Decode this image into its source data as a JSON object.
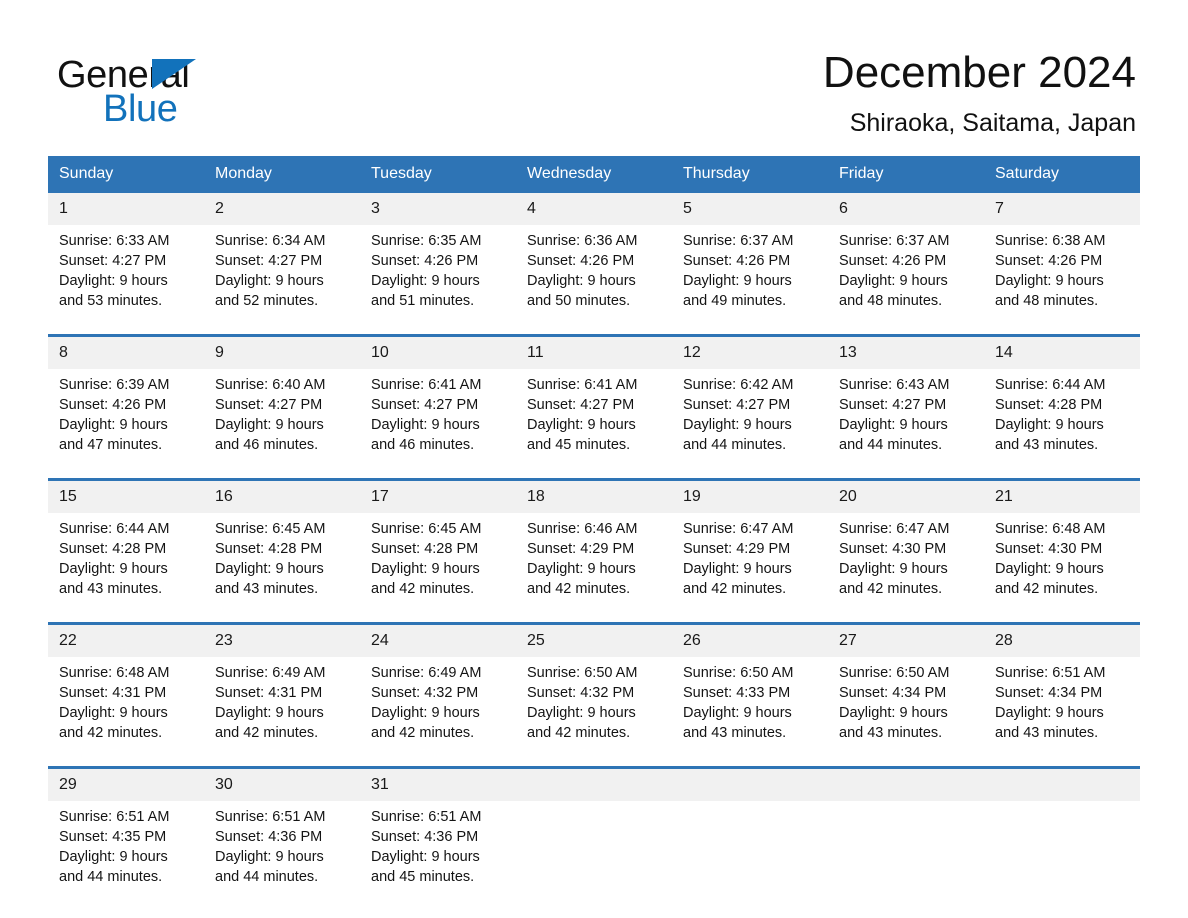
{
  "brand": {
    "name_part1": "General",
    "name_part2": "Blue",
    "accent_color": "#1272bb"
  },
  "header": {
    "title": "December 2024",
    "location": "Shiraoka, Saitama, Japan"
  },
  "theme": {
    "header_blue": "#2e74b5",
    "daynum_band": "#f1f1f1",
    "text": "#141414"
  },
  "weekdays": [
    "Sunday",
    "Monday",
    "Tuesday",
    "Wednesday",
    "Thursday",
    "Friday",
    "Saturday"
  ],
  "weeks": [
    {
      "days": [
        {
          "date": "1",
          "sunrise": "Sunrise: 6:33 AM",
          "sunset": "Sunset: 4:27 PM",
          "daylight1": "Daylight: 9 hours",
          "daylight2": "and 53 minutes."
        },
        {
          "date": "2",
          "sunrise": "Sunrise: 6:34 AM",
          "sunset": "Sunset: 4:27 PM",
          "daylight1": "Daylight: 9 hours",
          "daylight2": "and 52 minutes."
        },
        {
          "date": "3",
          "sunrise": "Sunrise: 6:35 AM",
          "sunset": "Sunset: 4:26 PM",
          "daylight1": "Daylight: 9 hours",
          "daylight2": "and 51 minutes."
        },
        {
          "date": "4",
          "sunrise": "Sunrise: 6:36 AM",
          "sunset": "Sunset: 4:26 PM",
          "daylight1": "Daylight: 9 hours",
          "daylight2": "and 50 minutes."
        },
        {
          "date": "5",
          "sunrise": "Sunrise: 6:37 AM",
          "sunset": "Sunset: 4:26 PM",
          "daylight1": "Daylight: 9 hours",
          "daylight2": "and 49 minutes."
        },
        {
          "date": "6",
          "sunrise": "Sunrise: 6:37 AM",
          "sunset": "Sunset: 4:26 PM",
          "daylight1": "Daylight: 9 hours",
          "daylight2": "and 48 minutes."
        },
        {
          "date": "7",
          "sunrise": "Sunrise: 6:38 AM",
          "sunset": "Sunset: 4:26 PM",
          "daylight1": "Daylight: 9 hours",
          "daylight2": "and 48 minutes."
        }
      ]
    },
    {
      "days": [
        {
          "date": "8",
          "sunrise": "Sunrise: 6:39 AM",
          "sunset": "Sunset: 4:26 PM",
          "daylight1": "Daylight: 9 hours",
          "daylight2": "and 47 minutes."
        },
        {
          "date": "9",
          "sunrise": "Sunrise: 6:40 AM",
          "sunset": "Sunset: 4:27 PM",
          "daylight1": "Daylight: 9 hours",
          "daylight2": "and 46 minutes."
        },
        {
          "date": "10",
          "sunrise": "Sunrise: 6:41 AM",
          "sunset": "Sunset: 4:27 PM",
          "daylight1": "Daylight: 9 hours",
          "daylight2": "and 46 minutes."
        },
        {
          "date": "11",
          "sunrise": "Sunrise: 6:41 AM",
          "sunset": "Sunset: 4:27 PM",
          "daylight1": "Daylight: 9 hours",
          "daylight2": "and 45 minutes."
        },
        {
          "date": "12",
          "sunrise": "Sunrise: 6:42 AM",
          "sunset": "Sunset: 4:27 PM",
          "daylight1": "Daylight: 9 hours",
          "daylight2": "and 44 minutes."
        },
        {
          "date": "13",
          "sunrise": "Sunrise: 6:43 AM",
          "sunset": "Sunset: 4:27 PM",
          "daylight1": "Daylight: 9 hours",
          "daylight2": "and 44 minutes."
        },
        {
          "date": "14",
          "sunrise": "Sunrise: 6:44 AM",
          "sunset": "Sunset: 4:28 PM",
          "daylight1": "Daylight: 9 hours",
          "daylight2": "and 43 minutes."
        }
      ]
    },
    {
      "days": [
        {
          "date": "15",
          "sunrise": "Sunrise: 6:44 AM",
          "sunset": "Sunset: 4:28 PM",
          "daylight1": "Daylight: 9 hours",
          "daylight2": "and 43 minutes."
        },
        {
          "date": "16",
          "sunrise": "Sunrise: 6:45 AM",
          "sunset": "Sunset: 4:28 PM",
          "daylight1": "Daylight: 9 hours",
          "daylight2": "and 43 minutes."
        },
        {
          "date": "17",
          "sunrise": "Sunrise: 6:45 AM",
          "sunset": "Sunset: 4:28 PM",
          "daylight1": "Daylight: 9 hours",
          "daylight2": "and 42 minutes."
        },
        {
          "date": "18",
          "sunrise": "Sunrise: 6:46 AM",
          "sunset": "Sunset: 4:29 PM",
          "daylight1": "Daylight: 9 hours",
          "daylight2": "and 42 minutes."
        },
        {
          "date": "19",
          "sunrise": "Sunrise: 6:47 AM",
          "sunset": "Sunset: 4:29 PM",
          "daylight1": "Daylight: 9 hours",
          "daylight2": "and 42 minutes."
        },
        {
          "date": "20",
          "sunrise": "Sunrise: 6:47 AM",
          "sunset": "Sunset: 4:30 PM",
          "daylight1": "Daylight: 9 hours",
          "daylight2": "and 42 minutes."
        },
        {
          "date": "21",
          "sunrise": "Sunrise: 6:48 AM",
          "sunset": "Sunset: 4:30 PM",
          "daylight1": "Daylight: 9 hours",
          "daylight2": "and 42 minutes."
        }
      ]
    },
    {
      "days": [
        {
          "date": "22",
          "sunrise": "Sunrise: 6:48 AM",
          "sunset": "Sunset: 4:31 PM",
          "daylight1": "Daylight: 9 hours",
          "daylight2": "and 42 minutes."
        },
        {
          "date": "23",
          "sunrise": "Sunrise: 6:49 AM",
          "sunset": "Sunset: 4:31 PM",
          "daylight1": "Daylight: 9 hours",
          "daylight2": "and 42 minutes."
        },
        {
          "date": "24",
          "sunrise": "Sunrise: 6:49 AM",
          "sunset": "Sunset: 4:32 PM",
          "daylight1": "Daylight: 9 hours",
          "daylight2": "and 42 minutes."
        },
        {
          "date": "25",
          "sunrise": "Sunrise: 6:50 AM",
          "sunset": "Sunset: 4:32 PM",
          "daylight1": "Daylight: 9 hours",
          "daylight2": "and 42 minutes."
        },
        {
          "date": "26",
          "sunrise": "Sunrise: 6:50 AM",
          "sunset": "Sunset: 4:33 PM",
          "daylight1": "Daylight: 9 hours",
          "daylight2": "and 43 minutes."
        },
        {
          "date": "27",
          "sunrise": "Sunrise: 6:50 AM",
          "sunset": "Sunset: 4:34 PM",
          "daylight1": "Daylight: 9 hours",
          "daylight2": "and 43 minutes."
        },
        {
          "date": "28",
          "sunrise": "Sunrise: 6:51 AM",
          "sunset": "Sunset: 4:34 PM",
          "daylight1": "Daylight: 9 hours",
          "daylight2": "and 43 minutes."
        }
      ]
    },
    {
      "days": [
        {
          "date": "29",
          "sunrise": "Sunrise: 6:51 AM",
          "sunset": "Sunset: 4:35 PM",
          "daylight1": "Daylight: 9 hours",
          "daylight2": "and 44 minutes."
        },
        {
          "date": "30",
          "sunrise": "Sunrise: 6:51 AM",
          "sunset": "Sunset: 4:36 PM",
          "daylight1": "Daylight: 9 hours",
          "daylight2": "and 44 minutes."
        },
        {
          "date": "31",
          "sunrise": "Sunrise: 6:51 AM",
          "sunset": "Sunset: 4:36 PM",
          "daylight1": "Daylight: 9 hours",
          "daylight2": "and 45 minutes."
        },
        {
          "date": "",
          "sunrise": "",
          "sunset": "",
          "daylight1": "",
          "daylight2": ""
        },
        {
          "date": "",
          "sunrise": "",
          "sunset": "",
          "daylight1": "",
          "daylight2": ""
        },
        {
          "date": "",
          "sunrise": "",
          "sunset": "",
          "daylight1": "",
          "daylight2": ""
        },
        {
          "date": "",
          "sunrise": "",
          "sunset": "",
          "daylight1": "",
          "daylight2": ""
        }
      ]
    }
  ]
}
